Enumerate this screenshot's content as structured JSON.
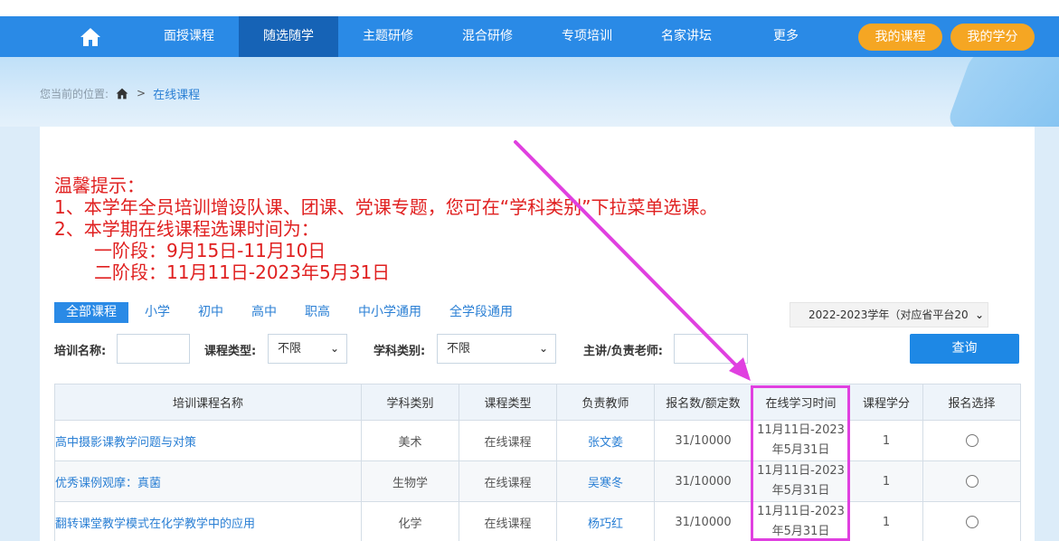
{
  "nav": {
    "items": [
      "面授课程",
      "随选随学",
      "主题研修",
      "混合研修",
      "专项培训",
      "名家讲坛",
      "更多"
    ],
    "active_index": 1,
    "my_courses": "我的课程",
    "my_credits": "我的学分"
  },
  "breadcrumb": {
    "prefix": "您当前的位置:",
    "separator": ">",
    "current": "在线课程"
  },
  "notice": {
    "title": "温馨提示：",
    "line1": "1、本学年全员培训增设队课、团课、党课专题，您可在“学科类别”下拉菜单选课。",
    "line2": "2、本学期在线课程选课时间为：",
    "phase1": "一阶段：9月15日-11月10日",
    "phase2": "二阶段：11月11日-2023年5月31日"
  },
  "tabs": [
    "全部课程",
    "小学",
    "初中",
    "高中",
    "职高",
    "中小学通用",
    "全学段通用"
  ],
  "active_tab": 0,
  "year_select": "2022-2023学年（对应省平台20",
  "filters": {
    "name_label": "培训名称:",
    "type_label": "课程类型:",
    "type_value": "不限",
    "subject_label": "学科类别:",
    "subject_value": "不限",
    "teacher_label": "主讲/负责老师:",
    "query_button": "查询"
  },
  "table": {
    "headers": [
      "培训课程名称",
      "学科类别",
      "课程类型",
      "负责教师",
      "报名数/额定数",
      "在线学习时间",
      "课程学分",
      "报名选择"
    ],
    "rows": [
      {
        "name": "高中摄影课教学问题与对策",
        "subject": "美术",
        "type": "在线课程",
        "teacher": "张文姜",
        "enroll": "31/10000",
        "time1": "11月11日-2023",
        "time2": "年5月31日",
        "credit": "1"
      },
      {
        "name": "优秀课例观摩：真菌",
        "subject": "生物学",
        "type": "在线课程",
        "teacher": "吴寒冬",
        "enroll": "31/10000",
        "time1": "11月11日-2023",
        "time2": "年5月31日",
        "credit": "1"
      },
      {
        "name": "翻转课堂教学模式在化学教学中的应用",
        "subject": "化学",
        "type": "在线课程",
        "teacher": "杨巧红",
        "enroll": "31/10000",
        "time1": "11月11日-2023",
        "time2": "年5月31日",
        "credit": "1"
      }
    ]
  },
  "colors": {
    "nav_bg": "#2a8ae6",
    "nav_active": "#1663b6",
    "pill": "#f5a623",
    "notice_red": "#e02020",
    "link_blue": "#2a7fd4",
    "highlight_magenta": "#e040e0"
  }
}
